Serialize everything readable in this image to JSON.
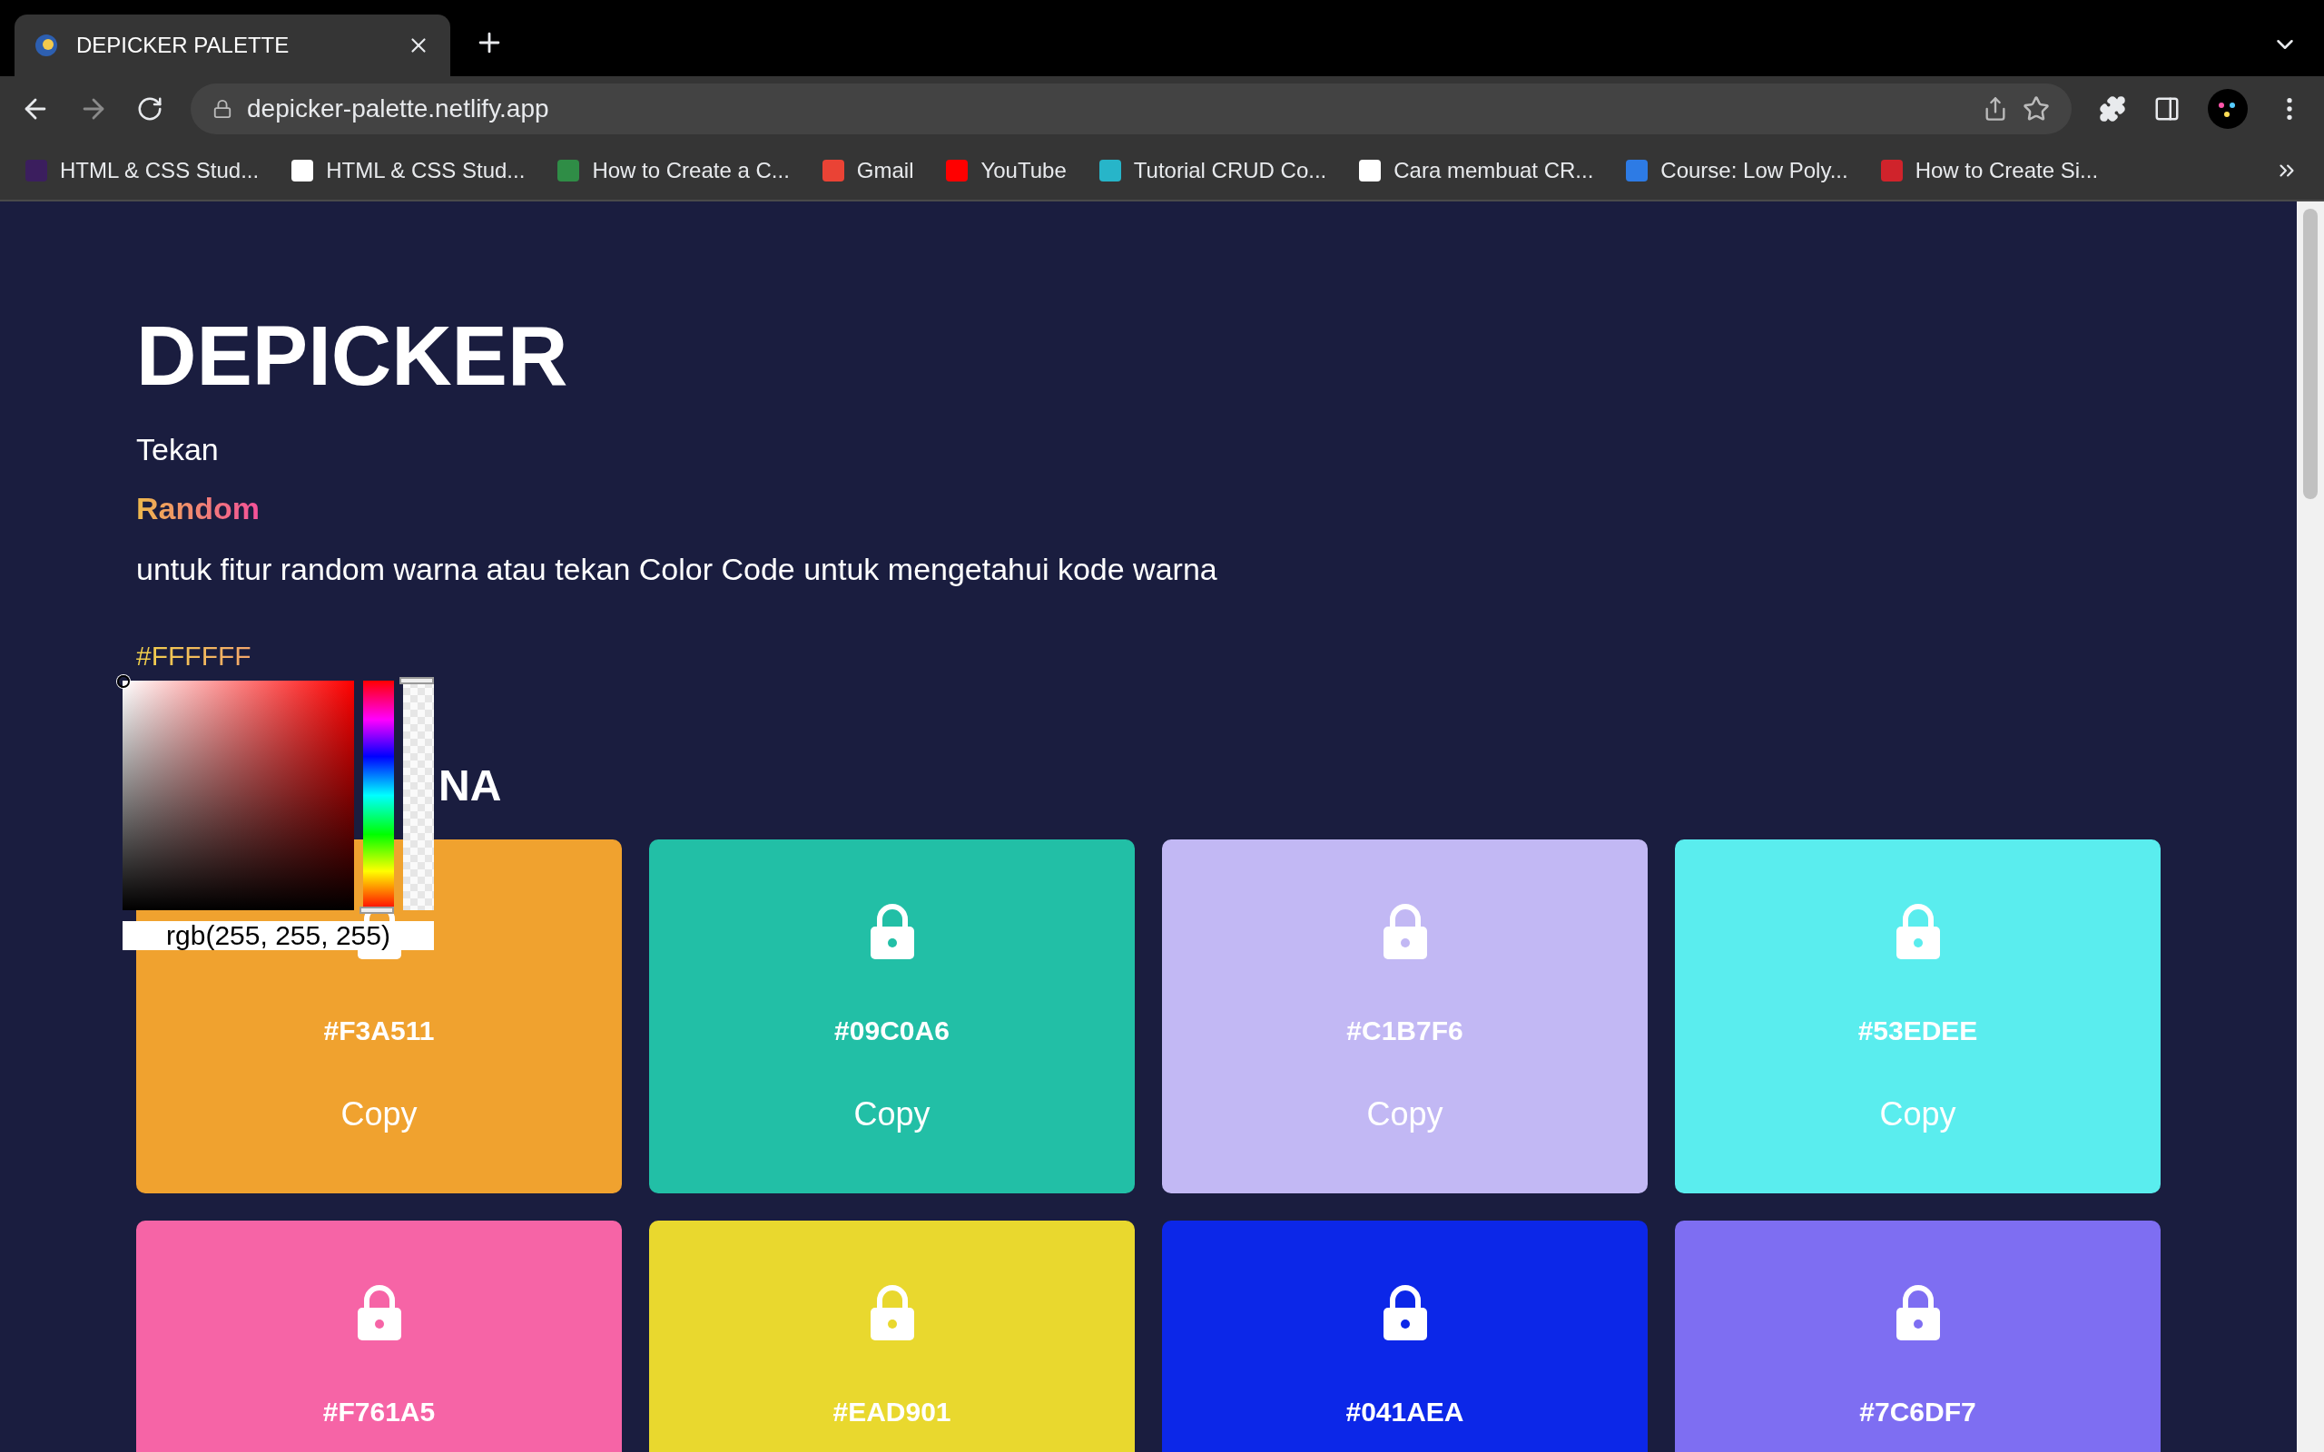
{
  "browser": {
    "tab": {
      "title": "DEPICKER PALETTE"
    },
    "url": "depicker-palette.netlify.app",
    "bookmarks": [
      {
        "label": "HTML & CSS Stud...",
        "color": "#3b1e5e"
      },
      {
        "label": "HTML & CSS Stud...",
        "color": "#ffffff"
      },
      {
        "label": "How to Create a C...",
        "color": "#2f8d46"
      },
      {
        "label": "Gmail",
        "color": "#ea4335"
      },
      {
        "label": "YouTube",
        "color": "#ff0000"
      },
      {
        "label": "Tutorial CRUD Co...",
        "color": "#27b5c9"
      },
      {
        "label": "Cara membuat CR...",
        "color": "#ffffff"
      },
      {
        "label": "Course: Low Poly...",
        "color": "#2d7be5"
      },
      {
        "label": "How to Create Si...",
        "color": "#d0232b"
      }
    ]
  },
  "page": {
    "title": "DEPICKER",
    "intro": "Tekan",
    "random_button": "Random",
    "description": "untuk fitur random warna atau tekan Color Code untuk mengetahui kode warna",
    "color_code": "#FFFFFF",
    "picker": {
      "value": "rgb(255, 255, 255)",
      "hue": {
        "level": 0
      },
      "alpha": {
        "level": 1
      }
    },
    "section_heading": "NA",
    "cards": [
      {
        "hex": "#F3A511",
        "color": "#f0a22f",
        "copy": "Copy"
      },
      {
        "hex": "#09C0A6",
        "color": "#22bfa6",
        "copy": "Copy"
      },
      {
        "hex": "#C1B7F6",
        "color": "#c2b8f4",
        "copy": "Copy"
      },
      {
        "hex": "#53EDEE",
        "color": "#5aedee",
        "copy": "Copy"
      },
      {
        "hex": "#F761A5",
        "color": "#f664a6"
      },
      {
        "hex": "#EAD901",
        "color": "#e9d82e"
      },
      {
        "hex": "#041AEA",
        "color": "#0c27e8"
      },
      {
        "hex": "#7C6DF7",
        "color": "#7e6ef2"
      }
    ]
  }
}
